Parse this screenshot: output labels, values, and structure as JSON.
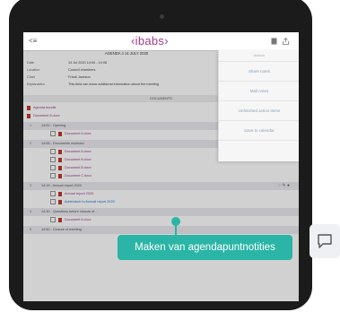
{
  "topbar": {
    "back_label": "<≡",
    "logo": "‹ibabs›"
  },
  "subtitle": "AGENDA 4 14 JULY 2020",
  "meta": [
    {
      "key": "Date",
      "value": "14 Jul 2020 14:00 - 14:08"
    },
    {
      "key": "Location",
      "value": "Council chambers"
    },
    {
      "key": "Chair",
      "value": "Frank Jackson"
    },
    {
      "key": "Explanation",
      "value": "This field can show additional information about the meeting."
    }
  ],
  "documents_header": "DOCUMENTS",
  "agenda_bundle": "Agenda bundle",
  "top_document": "Document 8.docx",
  "items": [
    {
      "num": "1",
      "label": "14:00 - Opening",
      "docs": [
        "Document 6.docx"
      ]
    },
    {
      "num": "2",
      "label": "14:05 - Documents received",
      "docs": [
        "Document 6.docx",
        "Document 8.docx",
        "Document B.docx",
        "Document C.docx"
      ]
    },
    {
      "num": "3",
      "label": "14:15 - Annual report 2020",
      "docs": [
        "Annual report 2020",
        "Addendum to Annual report 2020"
      ]
    },
    {
      "num": "4",
      "label": "14:30 - Questions before closure of ...",
      "docs": [
        "Document 8.docx"
      ]
    },
    {
      "num": "5",
      "label": "14:50 - Closure of meeting",
      "docs": []
    }
  ],
  "menu": {
    "header": "Actions",
    "items": [
      "Share notes",
      "Mail notes",
      "Unfinished action items",
      "Save to calendar"
    ]
  },
  "callout": "Maken van agendapuntnotities",
  "colors": {
    "accent": "#2ab5a6",
    "brand": "#9e3b8a"
  }
}
